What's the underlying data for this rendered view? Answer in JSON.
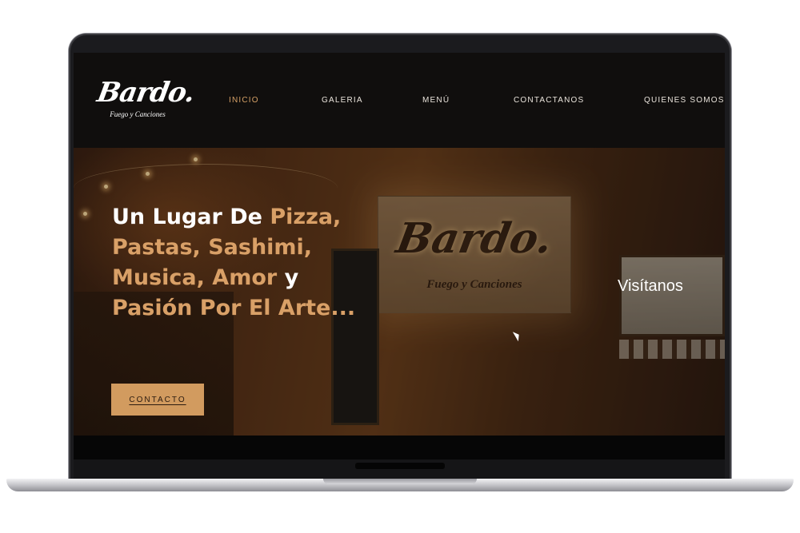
{
  "brand": {
    "logo_script": "Bardo.",
    "tagline": "Fuego y Canciones"
  },
  "nav": {
    "items": [
      {
        "label": "INICIO",
        "active": true
      },
      {
        "label": "GALERIA",
        "active": false
      },
      {
        "label": "MENÚ",
        "active": false
      },
      {
        "label": "CONTACTANOS",
        "active": false
      },
      {
        "label": "QUIENES SOMOS",
        "active": false
      }
    ]
  },
  "hero": {
    "headline_parts": [
      "Un Lugar De ",
      "Pizza,",
      "Pastas, Sashimi,",
      "Musica, Amor ",
      "y",
      "Pasión Por El Arte..."
    ],
    "cta_label": "CONTACTO",
    "visit_label": "Visítanos",
    "sign_script": "Bardo.",
    "sign_tagline": "Fuego y Canciones"
  },
  "colors": {
    "accent": "#d4a066",
    "header_bg": "#100e0d",
    "cta_bg": "#d29b5f"
  },
  "icons": [
    "cursor-pointer-icon"
  ]
}
